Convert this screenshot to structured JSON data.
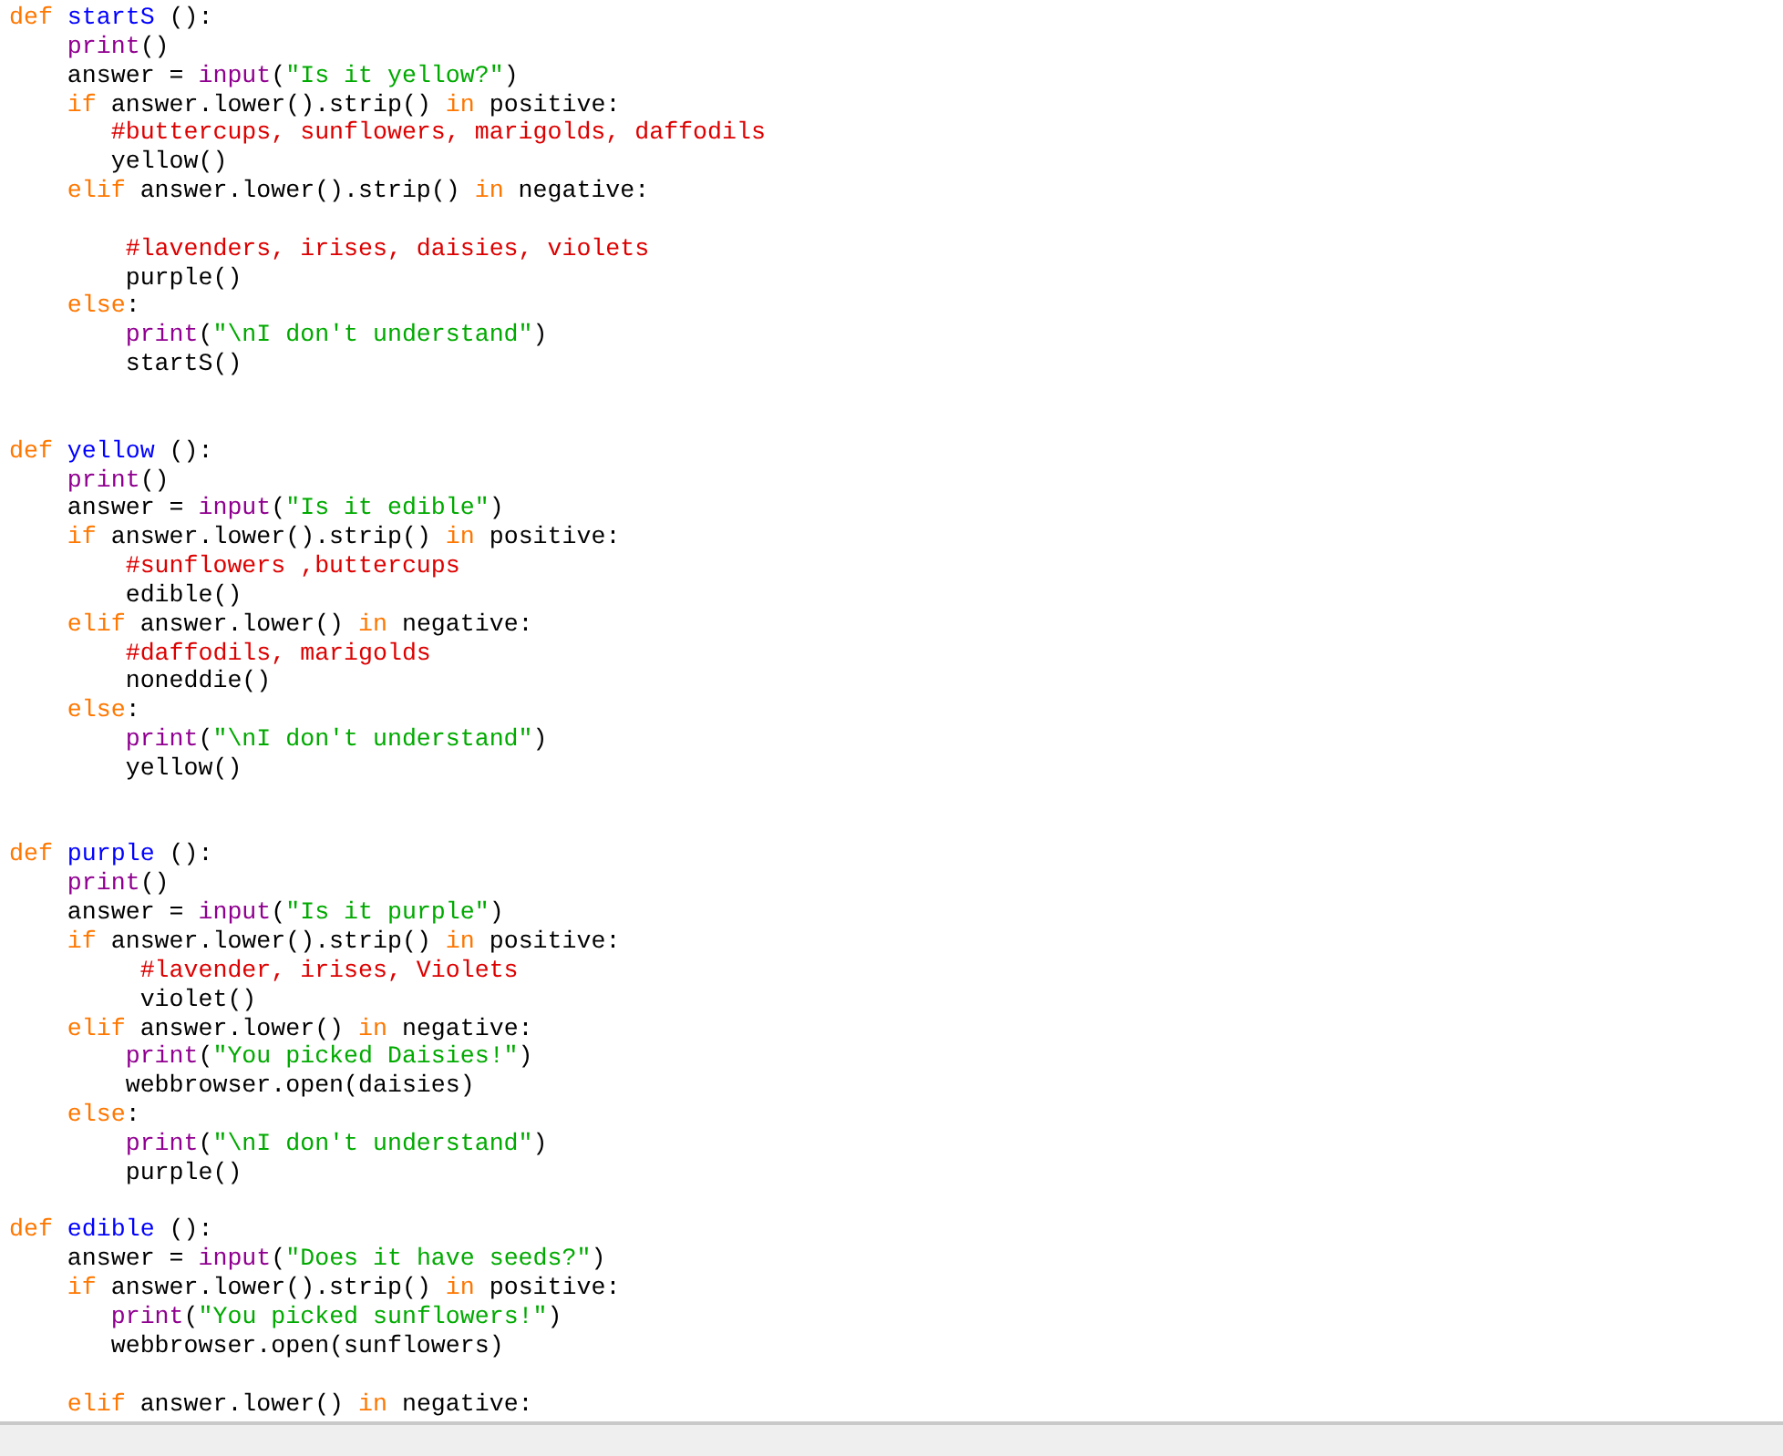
{
  "editor": {
    "lines": [
      {
        "kind": "code",
        "tokens": [
          {
            "kind": "keyword",
            "text": "def "
          },
          {
            "kind": "name",
            "text": "startS"
          },
          {
            "kind": "plain",
            "text": " ():"
          }
        ]
      },
      {
        "kind": "code",
        "tokens": [
          {
            "kind": "builtin",
            "text": "    print"
          },
          {
            "kind": "plain",
            "text": "()"
          }
        ]
      },
      {
        "kind": "code",
        "tokens": [
          {
            "kind": "plain",
            "text": "    answer = "
          },
          {
            "kind": "builtin",
            "text": "input"
          },
          {
            "kind": "plain",
            "text": "("
          },
          {
            "kind": "string",
            "text": "\"Is it yellow?\""
          },
          {
            "kind": "plain",
            "text": ")"
          }
        ]
      },
      {
        "kind": "code",
        "tokens": [
          {
            "kind": "keyword",
            "text": "    if"
          },
          {
            "kind": "plain",
            "text": " answer.lower().strip() "
          },
          {
            "kind": "keyword",
            "text": "in"
          },
          {
            "kind": "plain",
            "text": " positive:"
          }
        ]
      },
      {
        "kind": "code",
        "tokens": [
          {
            "kind": "comment",
            "text": "       #buttercups, sunflowers, marigolds, daffodils"
          }
        ]
      },
      {
        "kind": "code",
        "tokens": [
          {
            "kind": "plain",
            "text": "       yellow()"
          }
        ]
      },
      {
        "kind": "code",
        "tokens": [
          {
            "kind": "keyword",
            "text": "    elif"
          },
          {
            "kind": "plain",
            "text": " answer.lower().strip() "
          },
          {
            "kind": "keyword",
            "text": "in"
          },
          {
            "kind": "plain",
            "text": " negative:"
          }
        ]
      },
      {
        "kind": "blank"
      },
      {
        "kind": "code",
        "tokens": [
          {
            "kind": "comment",
            "text": "        #lavenders, irises, daisies, violets"
          }
        ]
      },
      {
        "kind": "code",
        "tokens": [
          {
            "kind": "plain",
            "text": "        purple()"
          }
        ]
      },
      {
        "kind": "code",
        "tokens": [
          {
            "kind": "keyword",
            "text": "    else"
          },
          {
            "kind": "plain",
            "text": ":"
          }
        ]
      },
      {
        "kind": "code",
        "tokens": [
          {
            "kind": "builtin",
            "text": "        print"
          },
          {
            "kind": "plain",
            "text": "("
          },
          {
            "kind": "string",
            "text": "\"\\nI don't understand\""
          },
          {
            "kind": "plain",
            "text": ")"
          }
        ]
      },
      {
        "kind": "code",
        "tokens": [
          {
            "kind": "plain",
            "text": "        startS()"
          }
        ]
      },
      {
        "kind": "blank"
      },
      {
        "kind": "blank"
      },
      {
        "kind": "code",
        "tokens": [
          {
            "kind": "keyword",
            "text": "def "
          },
          {
            "kind": "name",
            "text": "yellow"
          },
          {
            "kind": "plain",
            "text": " ():"
          }
        ]
      },
      {
        "kind": "code",
        "tokens": [
          {
            "kind": "builtin",
            "text": "    print"
          },
          {
            "kind": "plain",
            "text": "()"
          }
        ]
      },
      {
        "kind": "code",
        "tokens": [
          {
            "kind": "plain",
            "text": "    answer = "
          },
          {
            "kind": "builtin",
            "text": "input"
          },
          {
            "kind": "plain",
            "text": "("
          },
          {
            "kind": "string",
            "text": "\"Is it edible\""
          },
          {
            "kind": "plain",
            "text": ")"
          }
        ]
      },
      {
        "kind": "code",
        "tokens": [
          {
            "kind": "keyword",
            "text": "    if"
          },
          {
            "kind": "plain",
            "text": " answer.lower().strip() "
          },
          {
            "kind": "keyword",
            "text": "in"
          },
          {
            "kind": "plain",
            "text": " positive:"
          }
        ]
      },
      {
        "kind": "code",
        "tokens": [
          {
            "kind": "comment",
            "text": "        #sunflowers ,buttercups"
          }
        ]
      },
      {
        "kind": "code",
        "tokens": [
          {
            "kind": "plain",
            "text": "        edible()"
          }
        ]
      },
      {
        "kind": "code",
        "tokens": [
          {
            "kind": "keyword",
            "text": "    elif"
          },
          {
            "kind": "plain",
            "text": " answer.lower() "
          },
          {
            "kind": "keyword",
            "text": "in"
          },
          {
            "kind": "plain",
            "text": " negative:"
          }
        ]
      },
      {
        "kind": "code",
        "tokens": [
          {
            "kind": "comment",
            "text": "        #daffodils, marigolds"
          }
        ]
      },
      {
        "kind": "code",
        "tokens": [
          {
            "kind": "plain",
            "text": "        noneddie()"
          }
        ]
      },
      {
        "kind": "code",
        "tokens": [
          {
            "kind": "keyword",
            "text": "    else"
          },
          {
            "kind": "plain",
            "text": ":"
          }
        ]
      },
      {
        "kind": "code",
        "tokens": [
          {
            "kind": "builtin",
            "text": "        print"
          },
          {
            "kind": "plain",
            "text": "("
          },
          {
            "kind": "string",
            "text": "\"\\nI don't understand\""
          },
          {
            "kind": "plain",
            "text": ")"
          }
        ]
      },
      {
        "kind": "code",
        "tokens": [
          {
            "kind": "plain",
            "text": "        yellow()"
          }
        ]
      },
      {
        "kind": "blank"
      },
      {
        "kind": "blank"
      },
      {
        "kind": "code",
        "tokens": [
          {
            "kind": "keyword",
            "text": "def "
          },
          {
            "kind": "name",
            "text": "purple"
          },
          {
            "kind": "plain",
            "text": " ():"
          }
        ]
      },
      {
        "kind": "code",
        "tokens": [
          {
            "kind": "builtin",
            "text": "    print"
          },
          {
            "kind": "plain",
            "text": "()"
          }
        ]
      },
      {
        "kind": "code",
        "tokens": [
          {
            "kind": "plain",
            "text": "    answer = "
          },
          {
            "kind": "builtin",
            "text": "input"
          },
          {
            "kind": "plain",
            "text": "("
          },
          {
            "kind": "string",
            "text": "\"Is it purple\""
          },
          {
            "kind": "plain",
            "text": ")"
          }
        ]
      },
      {
        "kind": "code",
        "tokens": [
          {
            "kind": "keyword",
            "text": "    if"
          },
          {
            "kind": "plain",
            "text": " answer.lower().strip() "
          },
          {
            "kind": "keyword",
            "text": "in"
          },
          {
            "kind": "plain",
            "text": " positive:"
          }
        ]
      },
      {
        "kind": "code",
        "tokens": [
          {
            "kind": "comment",
            "text": "         #lavender, irises, Violets"
          }
        ]
      },
      {
        "kind": "code",
        "tokens": [
          {
            "kind": "plain",
            "text": "         violet()"
          }
        ]
      },
      {
        "kind": "code",
        "tokens": [
          {
            "kind": "keyword",
            "text": "    elif"
          },
          {
            "kind": "plain",
            "text": " answer.lower() "
          },
          {
            "kind": "keyword",
            "text": "in"
          },
          {
            "kind": "plain",
            "text": " negative:"
          }
        ]
      },
      {
        "kind": "code",
        "tokens": [
          {
            "kind": "builtin",
            "text": "        print"
          },
          {
            "kind": "plain",
            "text": "("
          },
          {
            "kind": "string",
            "text": "\"You picked Daisies!\""
          },
          {
            "kind": "plain",
            "text": ")"
          }
        ]
      },
      {
        "kind": "code",
        "tokens": [
          {
            "kind": "plain",
            "text": "        webbrowser.open(daisies)"
          }
        ]
      },
      {
        "kind": "code",
        "tokens": [
          {
            "kind": "keyword",
            "text": "    else"
          },
          {
            "kind": "plain",
            "text": ":"
          }
        ]
      },
      {
        "kind": "code",
        "tokens": [
          {
            "kind": "builtin",
            "text": "        print"
          },
          {
            "kind": "plain",
            "text": "("
          },
          {
            "kind": "string",
            "text": "\"\\nI don't understand\""
          },
          {
            "kind": "plain",
            "text": ")"
          }
        ]
      },
      {
        "kind": "code",
        "tokens": [
          {
            "kind": "plain",
            "text": "        purple()"
          }
        ]
      },
      {
        "kind": "blank"
      },
      {
        "kind": "code",
        "tokens": [
          {
            "kind": "keyword",
            "text": "def "
          },
          {
            "kind": "name",
            "text": "edible"
          },
          {
            "kind": "plain",
            "text": " ():"
          }
        ]
      },
      {
        "kind": "code",
        "tokens": [
          {
            "kind": "plain",
            "text": "    answer = "
          },
          {
            "kind": "builtin",
            "text": "input"
          },
          {
            "kind": "plain",
            "text": "("
          },
          {
            "kind": "string",
            "text": "\"Does it have seeds?\""
          },
          {
            "kind": "plain",
            "text": ")"
          }
        ]
      },
      {
        "kind": "code",
        "tokens": [
          {
            "kind": "keyword",
            "text": "    if"
          },
          {
            "kind": "plain",
            "text": " answer.lower().strip() "
          },
          {
            "kind": "keyword",
            "text": "in"
          },
          {
            "kind": "plain",
            "text": " positive:"
          }
        ]
      },
      {
        "kind": "code",
        "tokens": [
          {
            "kind": "builtin",
            "text": "       print"
          },
          {
            "kind": "plain",
            "text": "("
          },
          {
            "kind": "string",
            "text": "\"You picked sunflowers!\""
          },
          {
            "kind": "plain",
            "text": ")"
          }
        ]
      },
      {
        "kind": "code",
        "tokens": [
          {
            "kind": "plain",
            "text": "       webbrowser.open(sunflowers)"
          }
        ]
      },
      {
        "kind": "blank"
      },
      {
        "kind": "code",
        "tokens": [
          {
            "kind": "keyword",
            "text": "    elif"
          },
          {
            "kind": "plain",
            "text": " answer.lower() "
          },
          {
            "kind": "keyword",
            "text": "in"
          },
          {
            "kind": "plain",
            "text": " negative:"
          }
        ]
      }
    ]
  }
}
